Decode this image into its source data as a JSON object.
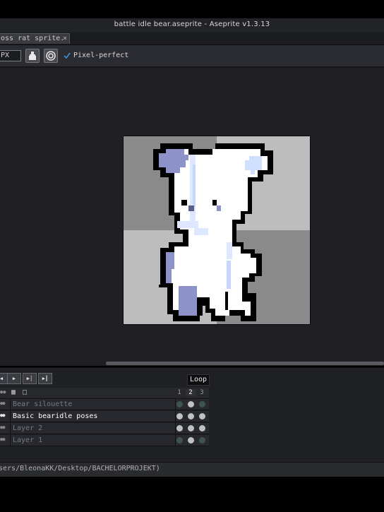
{
  "window": {
    "title": "battle idle bear.aseprite - Aseprite v1.3.13"
  },
  "tabs": [
    {
      "label": "oss rat sprite.",
      "close": "×"
    }
  ],
  "toolbar": {
    "size_value": "PX",
    "pixel_perfect_label": "Pixel-perfect",
    "pixel_perfect_checked": true
  },
  "timeline": {
    "loop_label": "Loop",
    "playback_buttons": [
      "first-frame",
      "play",
      "next-frame",
      "last-frame"
    ],
    "frames": [
      "1",
      "2",
      "3"
    ],
    "current_frame": "2",
    "layers": [
      {
        "name": "Bear silouette",
        "cels": [
          false,
          true,
          false
        ],
        "active": false
      },
      {
        "name": "Basic bearidle poses",
        "cels": [
          true,
          true,
          true
        ],
        "active": true
      },
      {
        "name": "Layer 2",
        "cels": [
          true,
          true,
          true
        ],
        "active": false
      },
      {
        "name": "Layer 1",
        "cels": [
          false,
          true,
          false
        ],
        "active": false
      }
    ]
  },
  "statusbar": {
    "path": "sers/BleonaKK/Desktop/BACHELORPROJEKT)"
  },
  "colors": {
    "accent": "#4a8cd6",
    "bear_white": "#ffffff",
    "bear_lavender": "#8d92c8",
    "bear_light_blue": "#cfe0ff",
    "outline": "#000000"
  }
}
